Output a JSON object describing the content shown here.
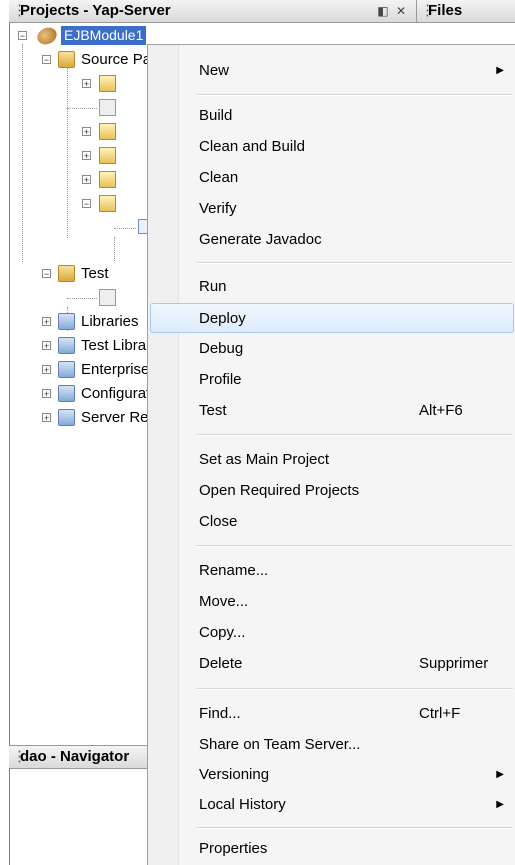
{
  "projects_panel": {
    "title": "Projects - Yap-Server"
  },
  "files_panel": {
    "title": "Files"
  },
  "navigator_panel": {
    "title": "dao - Navigator"
  },
  "tree": {
    "root": "EJBModule1",
    "items": [
      {
        "label": "Source Packages"
      },
      {
        "label": "Test"
      },
      {
        "label": "Libraries"
      },
      {
        "label": "Test Libraries"
      },
      {
        "label": "Enterprise Beans"
      },
      {
        "label": "Configuration Files"
      },
      {
        "label": "Server Resources"
      }
    ]
  },
  "context_menu": {
    "items": [
      {
        "label": "New",
        "submenu": true
      },
      {
        "label": "Build"
      },
      {
        "label": "Clean and Build"
      },
      {
        "label": "Clean"
      },
      {
        "label": "Verify"
      },
      {
        "label": "Generate Javadoc"
      },
      {
        "label": "Run"
      },
      {
        "label": "Deploy",
        "highlighted": true
      },
      {
        "label": "Debug"
      },
      {
        "label": "Profile"
      },
      {
        "label": "Test",
        "shortcut": "Alt+F6"
      },
      {
        "label": "Set as Main Project"
      },
      {
        "label": "Open Required Projects"
      },
      {
        "label": "Close"
      },
      {
        "label": "Rename..."
      },
      {
        "label": "Move..."
      },
      {
        "label": "Copy..."
      },
      {
        "label": "Delete",
        "shortcut": "Supprimer"
      },
      {
        "label": "Find...",
        "shortcut": "Ctrl+F"
      },
      {
        "label": "Share on Team Server..."
      },
      {
        "label": "Versioning",
        "submenu": true
      },
      {
        "label": "Local History",
        "submenu": true
      },
      {
        "label": "Properties"
      }
    ]
  }
}
